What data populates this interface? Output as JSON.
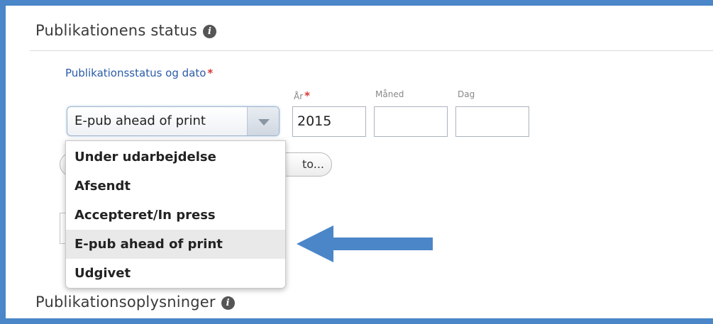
{
  "status_section": {
    "title": "Publikationens status",
    "info_icon": "info-icon"
  },
  "status_field": {
    "label": "Publikationsstatus og dato",
    "required_mark": "*",
    "selected_value": "E-pub ahead of print"
  },
  "date": {
    "year_label": "År",
    "year_required_mark": "*",
    "month_label": "Måned",
    "day_label": "Dag",
    "year_value": "2015",
    "month_value": "",
    "day_value": ""
  },
  "hidden_button": {
    "visible_text": "to..."
  },
  "dropdown": {
    "options": [
      {
        "label": "Under udarbejdelse"
      },
      {
        "label": "Afsendt"
      },
      {
        "label": "Accepteret/In press"
      },
      {
        "label": "E-pub ahead of print"
      },
      {
        "label": "Udgivet"
      }
    ],
    "selected_index": 3
  },
  "annotation": {
    "color": "#4a86c8"
  },
  "info_section": {
    "title": "Publikationsoplysninger",
    "info_icon": "info-icon"
  }
}
